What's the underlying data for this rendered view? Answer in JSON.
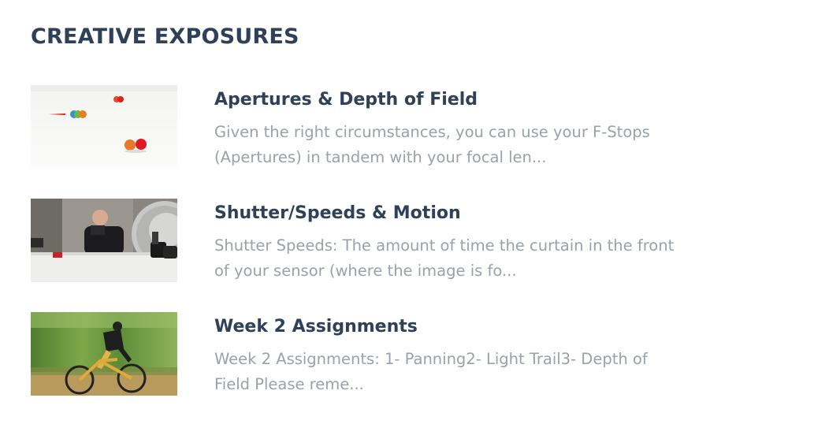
{
  "widget": {
    "title": "CREATIVE EXPOSURES"
  },
  "posts": [
    {
      "title": "Apertures & Depth of Field",
      "excerpt": "Given the right circumstances, you can use your F-Stops (Apertures) in tandem with your focal len...",
      "thumbnail": "colorful-balls-on-white-table-photo"
    },
    {
      "title": "Shutter/Speeds & Motion",
      "excerpt": "Shutter Speeds: The amount of time the curtain in the front of your sensor (where the image is fo...",
      "thumbnail": "photographer-with-camera-and-reflector-photo"
    },
    {
      "title": "Week 2 Assignments",
      "excerpt": "Week 2 Assignments: 1- Panning2- Light Trail3- Depth of Field Please reme...",
      "thumbnail": "mountain-biker-panning-motion-photo"
    }
  ],
  "colors": {
    "heading": "#2e4158",
    "excerpt": "#9aa1ab",
    "background": "#ffffff"
  }
}
